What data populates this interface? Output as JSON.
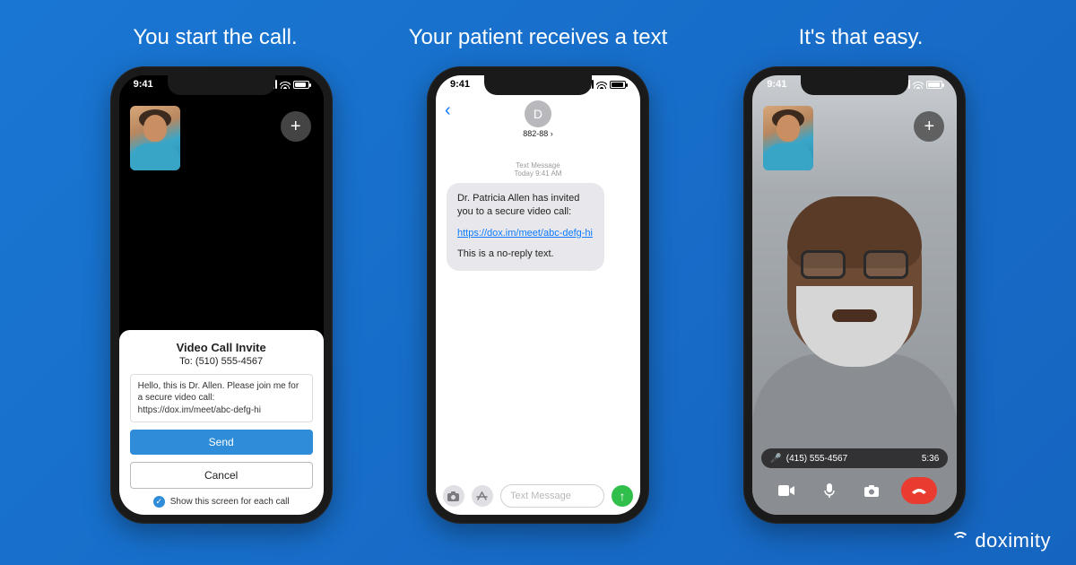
{
  "captions": {
    "step1": "You start the call.",
    "step2": "Your patient receives a text",
    "step3": "It's that easy."
  },
  "status_time": "9:41",
  "phone1": {
    "add_icon": "+",
    "sheet": {
      "title": "Video Call Invite",
      "to_label": "To: (510) 555-4567",
      "message": "Hello, this is Dr. Allen. Please join me for a secure video call:\nhttps://dox.im/meet/abc-defg-hi",
      "send_label": "Send",
      "cancel_label": "Cancel",
      "show_screen_label": "Show this screen for each call"
    }
  },
  "phone2": {
    "contact_initial": "D",
    "contact_line": "882-88 ›",
    "meta_line1": "Text Message",
    "meta_line2": "Today 9:41 AM",
    "bubble_line1": "Dr. Patricia Allen has invited you to a secure video call:",
    "bubble_link": "https://dox.im/meet/abc-defg-hi",
    "bubble_line2": "This is a no-reply text.",
    "compose_placeholder": "Text Message"
  },
  "phone3": {
    "add_icon": "+",
    "caller_number": "(415) 555-4567",
    "duration": "5:36"
  },
  "brand": "doximity"
}
